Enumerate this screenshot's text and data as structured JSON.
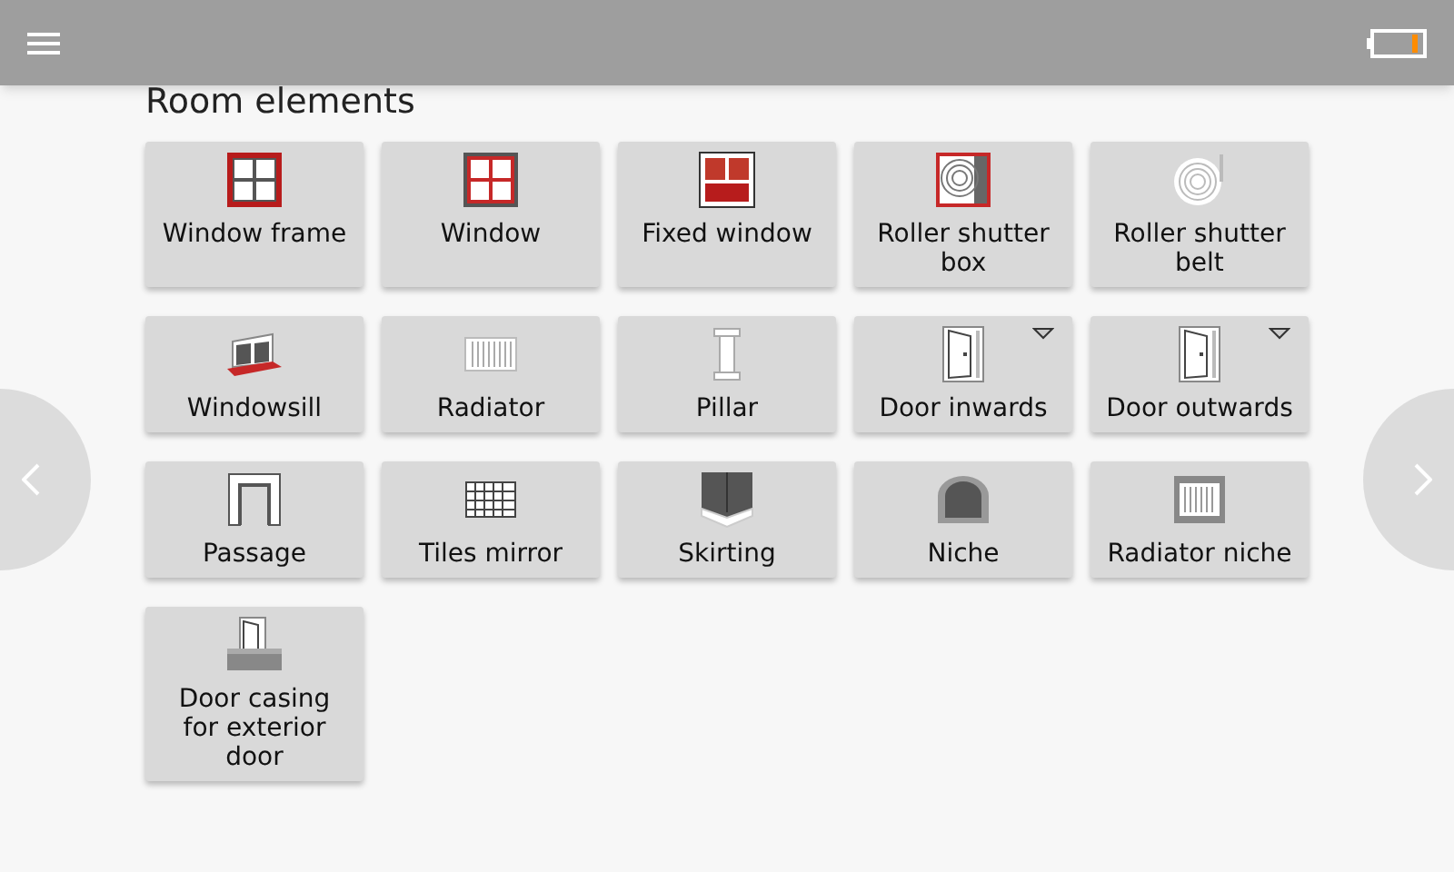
{
  "title": "Room elements",
  "tiles": [
    {
      "label": "Window frame",
      "kind": "window-frame",
      "has_menu": false
    },
    {
      "label": "Window",
      "kind": "window",
      "has_menu": false
    },
    {
      "label": "Fixed window",
      "kind": "fixed-window",
      "has_menu": false
    },
    {
      "label": "Roller shutter box",
      "kind": "shutter-box",
      "has_menu": false
    },
    {
      "label": "Roller shutter belt",
      "kind": "shutter-belt",
      "has_menu": false
    },
    {
      "label": "Windowsill",
      "kind": "windowsill",
      "has_menu": false
    },
    {
      "label": "Radiator",
      "kind": "radiator",
      "has_menu": false
    },
    {
      "label": "Pillar",
      "kind": "pillar",
      "has_menu": false
    },
    {
      "label": "Door inwards",
      "kind": "door",
      "has_menu": true
    },
    {
      "label": "Door outwards",
      "kind": "door",
      "has_menu": true
    },
    {
      "label": "Passage",
      "kind": "passage",
      "has_menu": false
    },
    {
      "label": "Tiles mirror",
      "kind": "tiles",
      "has_menu": false
    },
    {
      "label": "Skirting",
      "kind": "skirting",
      "has_menu": false
    },
    {
      "label": "Niche",
      "kind": "niche",
      "has_menu": false
    },
    {
      "label": "Radiator niche",
      "kind": "radiator-niche",
      "has_menu": false
    },
    {
      "label": "Door casing for exterior door",
      "kind": "door-casing",
      "has_menu": false
    }
  ]
}
